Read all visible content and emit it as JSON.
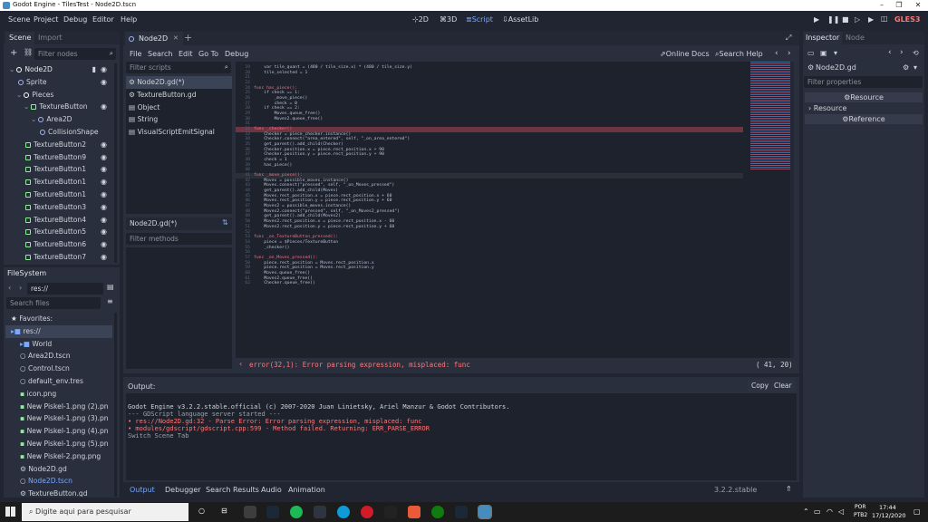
{
  "window": {
    "title": "Godot Engine - TilesTest - Node2D.tscn"
  },
  "menu": [
    "Scene",
    "Project",
    "Debug",
    "Editor",
    "Help"
  ],
  "workspaces": [
    {
      "label": "2D",
      "icon": "2d-icon"
    },
    {
      "label": "3D",
      "icon": "3d-icon"
    },
    {
      "label": "Script",
      "icon": "script-icon",
      "active": true
    },
    {
      "label": "AssetLib",
      "icon": "assetlib-icon"
    }
  ],
  "renderer": "GLES3",
  "scene_dock": {
    "tabs": [
      "Scene",
      "Import"
    ],
    "filter_placeholder": "Filter nodes",
    "tree": [
      {
        "label": "Node2D",
        "depth": 0,
        "color": "#ffffff"
      },
      {
        "label": "Sprite",
        "depth": 1,
        "color": "#a5b7f3"
      },
      {
        "label": "Pieces",
        "depth": 1,
        "color": "#ffffff"
      },
      {
        "label": "TextureButton",
        "depth": 2,
        "color": "#8eef97"
      },
      {
        "label": "Area2D",
        "depth": 3,
        "color": "#a5b7f3"
      },
      {
        "label": "CollisionShape",
        "depth": 4,
        "color": "#a5b7f3"
      },
      {
        "label": "TextureButton2",
        "depth": 2,
        "color": "#8eef97"
      },
      {
        "label": "TextureButton9",
        "depth": 2,
        "color": "#8eef97"
      },
      {
        "label": "TextureButton1",
        "depth": 2,
        "color": "#8eef97"
      },
      {
        "label": "TextureButton1",
        "depth": 2,
        "color": "#8eef97"
      },
      {
        "label": "TextureButton1",
        "depth": 2,
        "color": "#8eef97"
      },
      {
        "label": "TextureButton3",
        "depth": 2,
        "color": "#8eef97"
      },
      {
        "label": "TextureButton4",
        "depth": 2,
        "color": "#8eef97"
      },
      {
        "label": "TextureButton5",
        "depth": 2,
        "color": "#8eef97"
      },
      {
        "label": "TextureButton6",
        "depth": 2,
        "color": "#8eef97"
      },
      {
        "label": "TextureButton7",
        "depth": 2,
        "color": "#8eef97"
      }
    ]
  },
  "filesystem": {
    "title": "FileSystem",
    "path": "res://",
    "search_placeholder": "Search files",
    "items": [
      {
        "label": "Favorites:",
        "depth": 0
      },
      {
        "label": "res://",
        "depth": 0,
        "selected": true
      },
      {
        "label": "World",
        "depth": 1
      },
      {
        "label": "Area2D.tscn",
        "depth": 1
      },
      {
        "label": "Control.tscn",
        "depth": 1
      },
      {
        "label": "default_env.tres",
        "depth": 1
      },
      {
        "label": "icon.png",
        "depth": 1
      },
      {
        "label": "New Piskel-1.png (2).pn",
        "depth": 1
      },
      {
        "label": "New Piskel-1.png (3).pn",
        "depth": 1
      },
      {
        "label": "New Piskel-1.png (4).pn",
        "depth": 1
      },
      {
        "label": "New Piskel-1.png (5).pn",
        "depth": 1
      },
      {
        "label": "New Piskel-2.png.png",
        "depth": 1
      },
      {
        "label": "Node2D.gd",
        "depth": 1
      },
      {
        "label": "Node2D.tscn",
        "depth": 1,
        "highlight": true
      },
      {
        "label": "TextureButton.gd",
        "depth": 1
      }
    ]
  },
  "editor_tabs": {
    "active": "Node2D"
  },
  "script_menu": [
    "File",
    "Search",
    "Edit",
    "Go To",
    "Debug"
  ],
  "script_actions": {
    "online_docs": "Online Docs",
    "search_help": "Search Help"
  },
  "scripts": {
    "filter_placeholder": "Filter scripts",
    "list": [
      "Node2D.gd(*)",
      "TextureButton.gd",
      "Object",
      "String",
      "VisualScriptEmitSignal"
    ],
    "current": "Node2D.gd(*)",
    "methods_placeholder": "Filter methods"
  },
  "code": [
    {
      "n": "19",
      "t": "    var tile_quant = (480 / tile_size.x) * (480 / tile_size.y)"
    },
    {
      "n": "20",
      "t": "    tile_selected = 1"
    },
    {
      "n": "21",
      "t": ""
    },
    {
      "n": "22",
      "t": ""
    },
    {
      "n": "24",
      "t": "func has_piece():",
      "k": true
    },
    {
      "n": "25",
      "t": "    if check == 1:"
    },
    {
      "n": "26",
      "t": "        _move_piece()"
    },
    {
      "n": "27",
      "t": "        check = 0"
    },
    {
      "n": "28",
      "t": "    if check == 2:"
    },
    {
      "n": "29",
      "t": "        Moves.queue_free()"
    },
    {
      "n": "30",
      "t": "        Moves2.queue_free()"
    },
    {
      "n": "31",
      "t": ""
    },
    {
      "n": "32",
      "t": "func _checker()",
      "k": true,
      "error": true
    },
    {
      "n": "33",
      "t": "    Checker = piece_checker.instance()"
    },
    {
      "n": "34",
      "t": "    Checker.connect(\"area_entered\", self, \"_on_area_entered\")"
    },
    {
      "n": "35",
      "t": "    get_parent().add_child(Checker)"
    },
    {
      "n": "36",
      "t": "    Checker.position.x = piece.rect_position.x + 90"
    },
    {
      "n": "37",
      "t": "    Checker.position.y = piece.rect_position.y + 90"
    },
    {
      "n": "38",
      "t": "    check = 1"
    },
    {
      "n": "39",
      "t": "    has_piece()"
    },
    {
      "n": "40",
      "t": ""
    },
    {
      "n": "41",
      "t": "func _move_piece():",
      "k": true,
      "current": true
    },
    {
      "n": "42",
      "t": "    Moves = possible_moves.instance()"
    },
    {
      "n": "43",
      "t": "    Moves.connect(\"pressed\", self, \"_on_Moves_pressed\")"
    },
    {
      "n": "44",
      "t": "    get_parent().add_child(Moves)"
    },
    {
      "n": "45",
      "t": "    Moves.rect_position.x = piece.rect_position.x + 60"
    },
    {
      "n": "46",
      "t": "    Moves.rect_position.y = piece.rect_position.y + 60"
    },
    {
      "n": "47",
      "t": "    Moves2 = possible_moves.instance()"
    },
    {
      "n": "48",
      "t": "    Moves2.connect(\"pressed\", self, \"_on_Moves2_pressed\")"
    },
    {
      "n": "49",
      "t": "    get_parent().add_child(Moves2)"
    },
    {
      "n": "50",
      "t": "    Moves2.rect_position.x = piece.rect_position.x - 60"
    },
    {
      "n": "51",
      "t": "    Moves2.rect_position.y = piece.rect_position.y + 60"
    },
    {
      "n": "52",
      "t": ""
    },
    {
      "n": "53",
      "t": "func _on_TextureButton_pressed():",
      "k": true
    },
    {
      "n": "54",
      "t": "    piece = $Pieces/TextureButton"
    },
    {
      "n": "55",
      "t": "    _checker()"
    },
    {
      "n": "56",
      "t": ""
    },
    {
      "n": "57",
      "t": "func _on_Moves_pressed():",
      "k": true
    },
    {
      "n": "58",
      "t": "    piece.rect_position = Moves.rect_position.x"
    },
    {
      "n": "59",
      "t": "    piece.rect_position = Moves.rect_position.y"
    },
    {
      "n": "60",
      "t": "    Moves.queue_free()"
    },
    {
      "n": "61",
      "t": "    Moves2.queue_free()"
    },
    {
      "n": "62",
      "t": "    Checker.queue_free()"
    }
  ],
  "status": {
    "error": "error(32,1): Error parsing expression, misplaced: func",
    "cursor": "( 41, 20)"
  },
  "output": {
    "title": "Output:",
    "copy": "Copy",
    "clear": "Clear",
    "lines": [
      {
        "t": "Godot Engine v3.2.2.stable.official (c) 2007-2020 Juan Linietsky, Ariel Manzur & Godot Contributors.",
        "c": "normal"
      },
      {
        "t": "--- GDScript language server started ---",
        "c": "gray"
      },
      {
        "t": "• res://Node2D.gd:32 - Parse Error: Error parsing expression, misplaced: func",
        "c": "err"
      },
      {
        "t": "• modules/gdscript/gdscript.cpp:599 - Method failed. Returning: ERR_PARSE_ERROR",
        "c": "err"
      },
      {
        "t": "Switch Scene Tab",
        "c": "gray"
      }
    ]
  },
  "bottom_tabs": [
    "Output",
    "Debugger",
    "Search Results",
    "Audio",
    "Animation"
  ],
  "version": "3.2.2.stable",
  "inspector": {
    "tabs": [
      "Inspector",
      "Node"
    ],
    "object": "Node2D.gd",
    "filter_placeholder": "Filter properties",
    "sections": [
      "Resource",
      "Resource",
      "Reference"
    ]
  },
  "taskbar": {
    "search_placeholder": "Digite aqui para pesquisar",
    "lang": "POR",
    "layout": "PTB2",
    "time": "17:44",
    "date": "17/12/2020"
  },
  "colors": {
    "accent": "#78a8ff",
    "error": "#ff7878",
    "panel": "#2a2f3d",
    "bg": "#202531"
  }
}
